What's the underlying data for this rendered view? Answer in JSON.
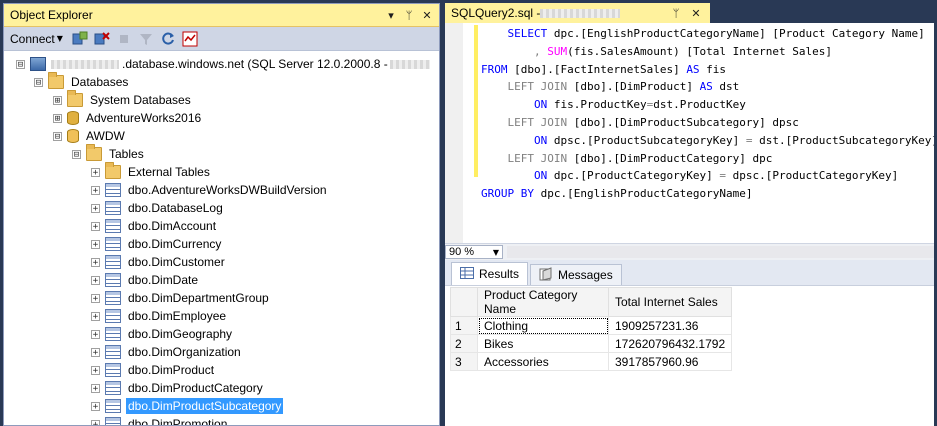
{
  "object_explorer": {
    "title": "Object Explorer",
    "title_buttons": [
      "▾",
      "ᛘ",
      "✕"
    ],
    "toolbar": {
      "connect_label": "Connect"
    },
    "tree": {
      "server": {
        "label": ".database.windows.net (SQL Server 12.0.2000.8 - ",
        "expander": "⊟"
      },
      "databases": {
        "label": "Databases",
        "expander": "⊟"
      },
      "system_databases": {
        "label": "System Databases",
        "expander": "⊞"
      },
      "adventureworks": {
        "label": "AdventureWorks2016",
        "expander": "⊞"
      },
      "awdw": {
        "label": "AWDW",
        "expander": "⊟"
      },
      "tables": {
        "label": "Tables",
        "expander": "⊟"
      },
      "items": [
        {
          "label": "External Tables",
          "icon": "folder-icon"
        },
        {
          "label": "dbo.AdventureWorksDWBuildVersion",
          "icon": "table-icon"
        },
        {
          "label": "dbo.DatabaseLog",
          "icon": "table-icon"
        },
        {
          "label": "dbo.DimAccount",
          "icon": "table-icon"
        },
        {
          "label": "dbo.DimCurrency",
          "icon": "table-icon"
        },
        {
          "label": "dbo.DimCustomer",
          "icon": "table-icon"
        },
        {
          "label": "dbo.DimDate",
          "icon": "table-icon"
        },
        {
          "label": "dbo.DimDepartmentGroup",
          "icon": "table-icon"
        },
        {
          "label": "dbo.DimEmployee",
          "icon": "table-icon"
        },
        {
          "label": "dbo.DimGeography",
          "icon": "table-icon"
        },
        {
          "label": "dbo.DimOrganization",
          "icon": "table-icon"
        },
        {
          "label": "dbo.DimProduct",
          "icon": "table-icon"
        },
        {
          "label": "dbo.DimProductCategory",
          "icon": "table-icon"
        },
        {
          "label": "dbo.DimProductSubcategory",
          "icon": "table-icon",
          "selected": true
        },
        {
          "label": "dbo.DimPromotion",
          "icon": "table-icon"
        }
      ]
    }
  },
  "query_editor": {
    "tab_title": "SQLQuery2.sql - ",
    "tab_buttons": [
      "ᛘ",
      "✕"
    ],
    "zoom": "90 %",
    "result_tabs": {
      "results": "Results",
      "messages": "Messages"
    },
    "results": {
      "columns": [
        "Product Category Name",
        "Total Internet Sales"
      ],
      "rows": [
        {
          "n": "1",
          "name": "Clothing",
          "sales": "1909257231.36"
        },
        {
          "n": "2",
          "name": "Bikes",
          "sales": "172620796432.1792"
        },
        {
          "n": "3",
          "name": "Accessories",
          "sales": "3917857960.96"
        }
      ]
    }
  },
  "sql_lines": [
    [
      {
        "t": "    "
      },
      {
        "t": "SELECT",
        "c": "kw"
      },
      {
        "t": " dpc.[EnglishProductCategoryName] [Product Category Name]"
      }
    ],
    [
      {
        "t": "        "
      },
      {
        "t": ",",
        "c": "op"
      },
      {
        "t": " "
      },
      {
        "t": "SUM",
        "c": "fn"
      },
      {
        "t": "(fis.SalesAmount) [Total Internet Sales]"
      }
    ],
    [
      {
        "t": "FROM",
        "c": "kw"
      },
      {
        "t": " [dbo].[FactInternetSales] "
      },
      {
        "t": "AS",
        "c": "kw"
      },
      {
        "t": " fis"
      }
    ],
    [
      {
        "t": "    "
      },
      {
        "t": "LEFT JOIN",
        "c": "op"
      },
      {
        "t": " [dbo].[DimProduct] "
      },
      {
        "t": "AS",
        "c": "kw"
      },
      {
        "t": " dst"
      }
    ],
    [
      {
        "t": "        "
      },
      {
        "t": "ON",
        "c": "kw"
      },
      {
        "t": " fis.ProductKey"
      },
      {
        "t": "=",
        "c": "op"
      },
      {
        "t": "dst.ProductKey"
      }
    ],
    [
      {
        "t": "    "
      },
      {
        "t": "LEFT JOIN",
        "c": "op"
      },
      {
        "t": " [dbo].[DimProductSubcategory] dpsc"
      }
    ],
    [
      {
        "t": "        "
      },
      {
        "t": "ON",
        "c": "kw"
      },
      {
        "t": " dpsc.[ProductSubcategoryKey] "
      },
      {
        "t": "=",
        "c": "op"
      },
      {
        "t": " dst.[ProductSubcategoryKey]"
      }
    ],
    [
      {
        "t": "    "
      },
      {
        "t": "LEFT JOIN",
        "c": "op"
      },
      {
        "t": " [dbo].[DimProductCategory] dpc"
      }
    ],
    [
      {
        "t": "        "
      },
      {
        "t": "ON",
        "c": "kw"
      },
      {
        "t": " dpc.[ProductCategoryKey] "
      },
      {
        "t": "=",
        "c": "op"
      },
      {
        "t": " dpsc.[ProductCategoryKey]"
      }
    ],
    [
      {
        "t": "GROUP BY",
        "c": "kw"
      },
      {
        "t": " dpc.[EnglishProductCategoryName]"
      }
    ]
  ]
}
